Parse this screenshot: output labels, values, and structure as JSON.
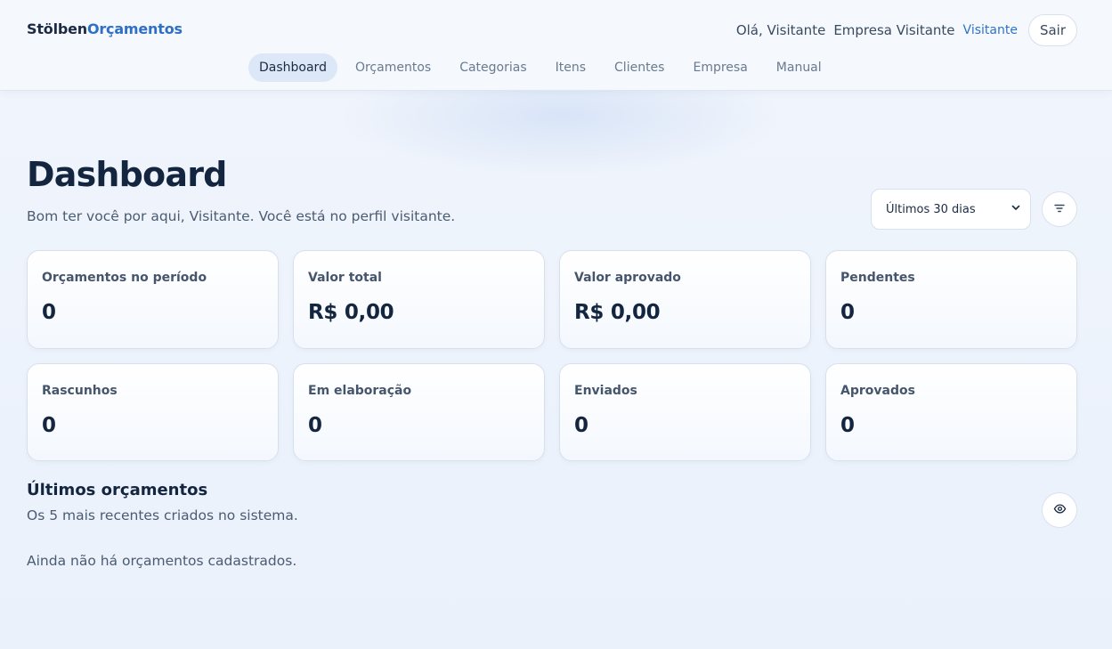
{
  "brand": {
    "part1": "Stölben",
    "part2": "Orçamentos"
  },
  "user": {
    "greeting": "Olá, Visitante",
    "company": "Empresa Visitante",
    "role": "Visitante",
    "logout_label": "Sair"
  },
  "nav": {
    "tabs": [
      {
        "label": "Dashboard",
        "active": true
      },
      {
        "label": "Orçamentos"
      },
      {
        "label": "Categorias"
      },
      {
        "label": "Itens"
      },
      {
        "label": "Clientes"
      },
      {
        "label": "Empresa"
      },
      {
        "label": "Manual"
      }
    ]
  },
  "page": {
    "title": "Dashboard",
    "subtitle": "Bom ter você por aqui, Visitante. Você está no perfil visitante."
  },
  "filters": {
    "period_selected": "Últimos 30 dias",
    "filter_icon": "filter-icon"
  },
  "stats": [
    {
      "label": "Orçamentos no período",
      "value": "0"
    },
    {
      "label": "Valor total",
      "value": "R$ 0,00"
    },
    {
      "label": "Valor aprovado",
      "value": "R$ 0,00"
    },
    {
      "label": "Pendentes",
      "value": "0"
    },
    {
      "label": "Rascunhos",
      "value": "0"
    },
    {
      "label": "Em elaboração",
      "value": "0"
    },
    {
      "label": "Enviados",
      "value": "0"
    },
    {
      "label": "Aprovados",
      "value": "0"
    }
  ],
  "recent": {
    "title": "Últimos orçamentos",
    "subtitle": "Os 5 mais recentes criados no sistema.",
    "empty_message": "Ainda não há orçamentos cadastrados.",
    "view_icon": "eye-icon"
  },
  "colors": {
    "accent": "#2f6fc6",
    "active_tab_bg": "#dce7f7",
    "text_dark": "#14253f"
  }
}
